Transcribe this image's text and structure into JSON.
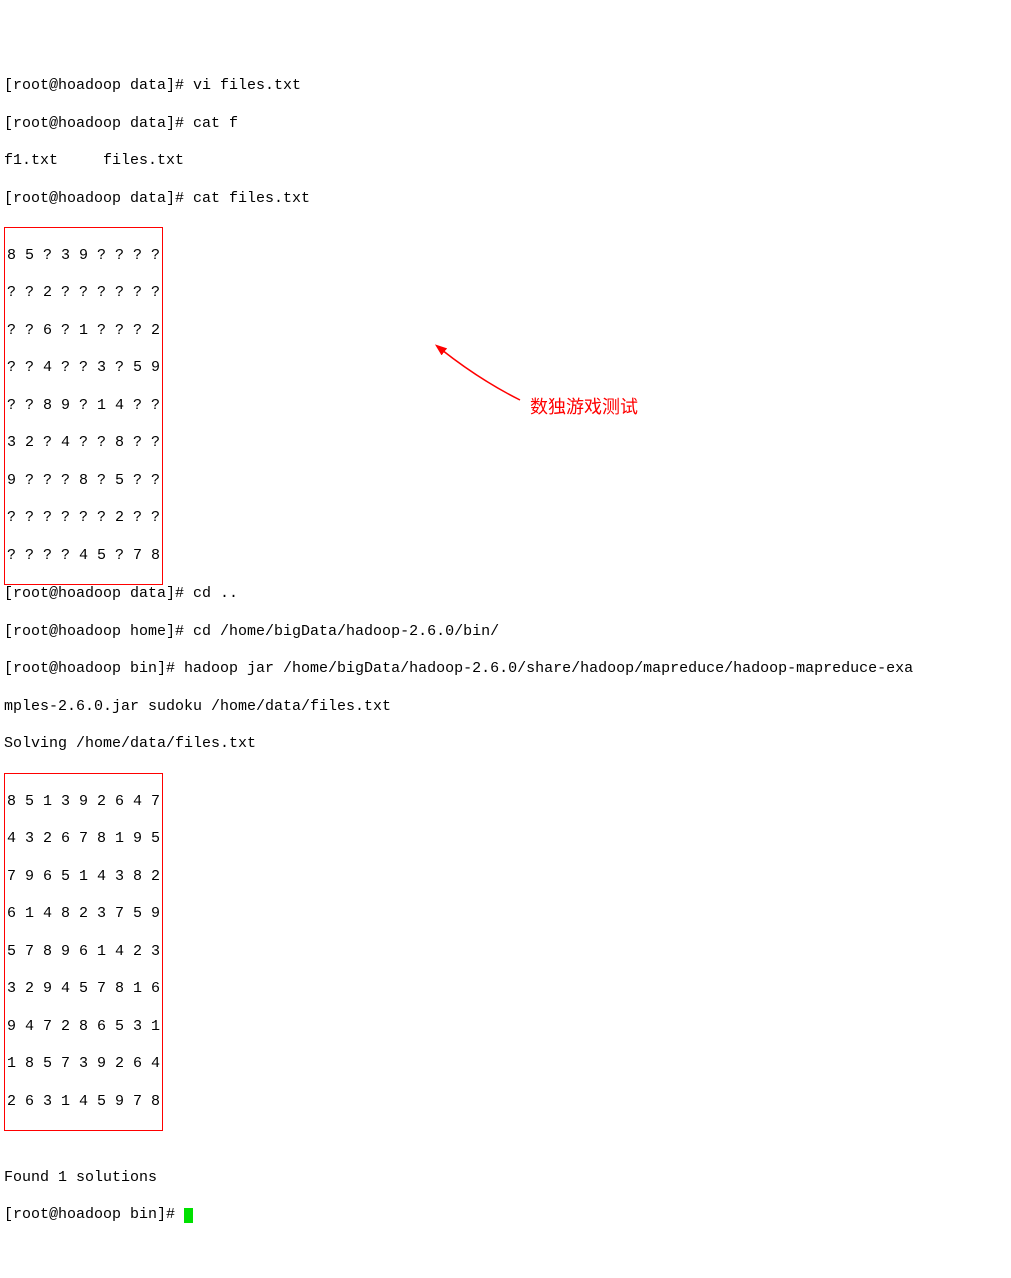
{
  "prompts": {
    "p1": "[root@hoadoop data]# ",
    "p2": "[root@hoadoop home]# ",
    "p3": "[root@hoadoop bin]# "
  },
  "cmds": {
    "vi": "vi files.txt",
    "catf": "cat f",
    "catfiles": "cat files.txt",
    "cdup": "cd ..",
    "cdbin": "cd /home/bigData/hadoop-2.6.0/bin/",
    "hadoop_a": "hadoop jar /home/bigData/hadoop-2.6.0/share/hadoop/mapreduce/hadoop-mapreduce-exa",
    "hadoop_b": "mples-2.6.0.jar sudoku /home/data/files.txt"
  },
  "out": {
    "catf": "f1.txt     files.txt",
    "solving": "Solving /home/data/files.txt",
    "found": "Found 1 solutions"
  },
  "puzzle": [
    "8 5 ? 3 9 ? ? ? ?",
    "? ? 2 ? ? ? ? ? ?",
    "? ? 6 ? 1 ? ? ? 2",
    "? ? 4 ? ? 3 ? 5 9",
    "? ? 8 9 ? 1 4 ? ?",
    "3 2 ? 4 ? ? 8 ? ?",
    "9 ? ? ? 8 ? 5 ? ?",
    "? ? ? ? ? ? 2 ? ?",
    "? ? ? ? 4 5 ? 7 8"
  ],
  "solution": [
    "8 5 1 3 9 2 6 4 7",
    "4 3 2 6 7 8 1 9 5",
    "7 9 6 5 1 4 3 8 2",
    "6 1 4 8 2 3 7 5 9",
    "5 7 8 9 6 1 4 2 3",
    "3 2 9 4 5 7 8 1 6",
    "9 4 7 2 8 6 5 3 1",
    "1 8 5 7 3 9 2 6 4",
    "2 6 3 1 4 5 9 7 8"
  ],
  "annotation": {
    "label": "数独游戏测试"
  }
}
